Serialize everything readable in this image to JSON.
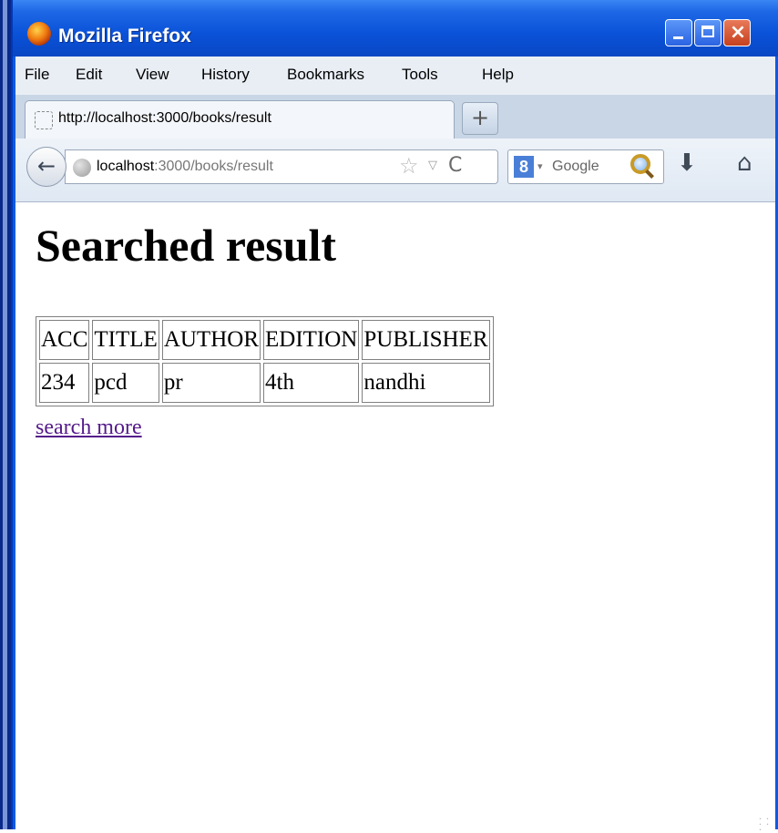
{
  "window": {
    "title": "Mozilla Firefox",
    "controls": {
      "minimize": "_",
      "maximize": "□",
      "close": "×"
    }
  },
  "menu": [
    "File",
    "Edit",
    "View",
    "History",
    "Bookmarks",
    "Tools",
    "Help"
  ],
  "tab": {
    "label": "http://localhost:3000/books/result",
    "new_tab": "+"
  },
  "navbar": {
    "back": "←",
    "url_host": "localhost",
    "url_rest": ":3000/books/result",
    "bookmark_star": "☆",
    "dropdown": "▽",
    "reload": "C",
    "search_engine_badge": "8",
    "search_dropdown": "▾",
    "search_placeholder": "Google",
    "download": "⬇",
    "home": "⌂"
  },
  "page": {
    "title": "Searched result",
    "table": {
      "headers": [
        "ACC",
        "TITLE",
        "AUTHOR",
        "EDITION",
        "PUBLISHER"
      ],
      "rows": [
        [
          "234",
          "pcd",
          "pr",
          "4th",
          "nandhi"
        ]
      ]
    },
    "link": "search more"
  },
  "colors": {
    "titlebar": "#0a52d8",
    "chrome": "#dbe5f1",
    "link_visited": "#551a8b"
  }
}
